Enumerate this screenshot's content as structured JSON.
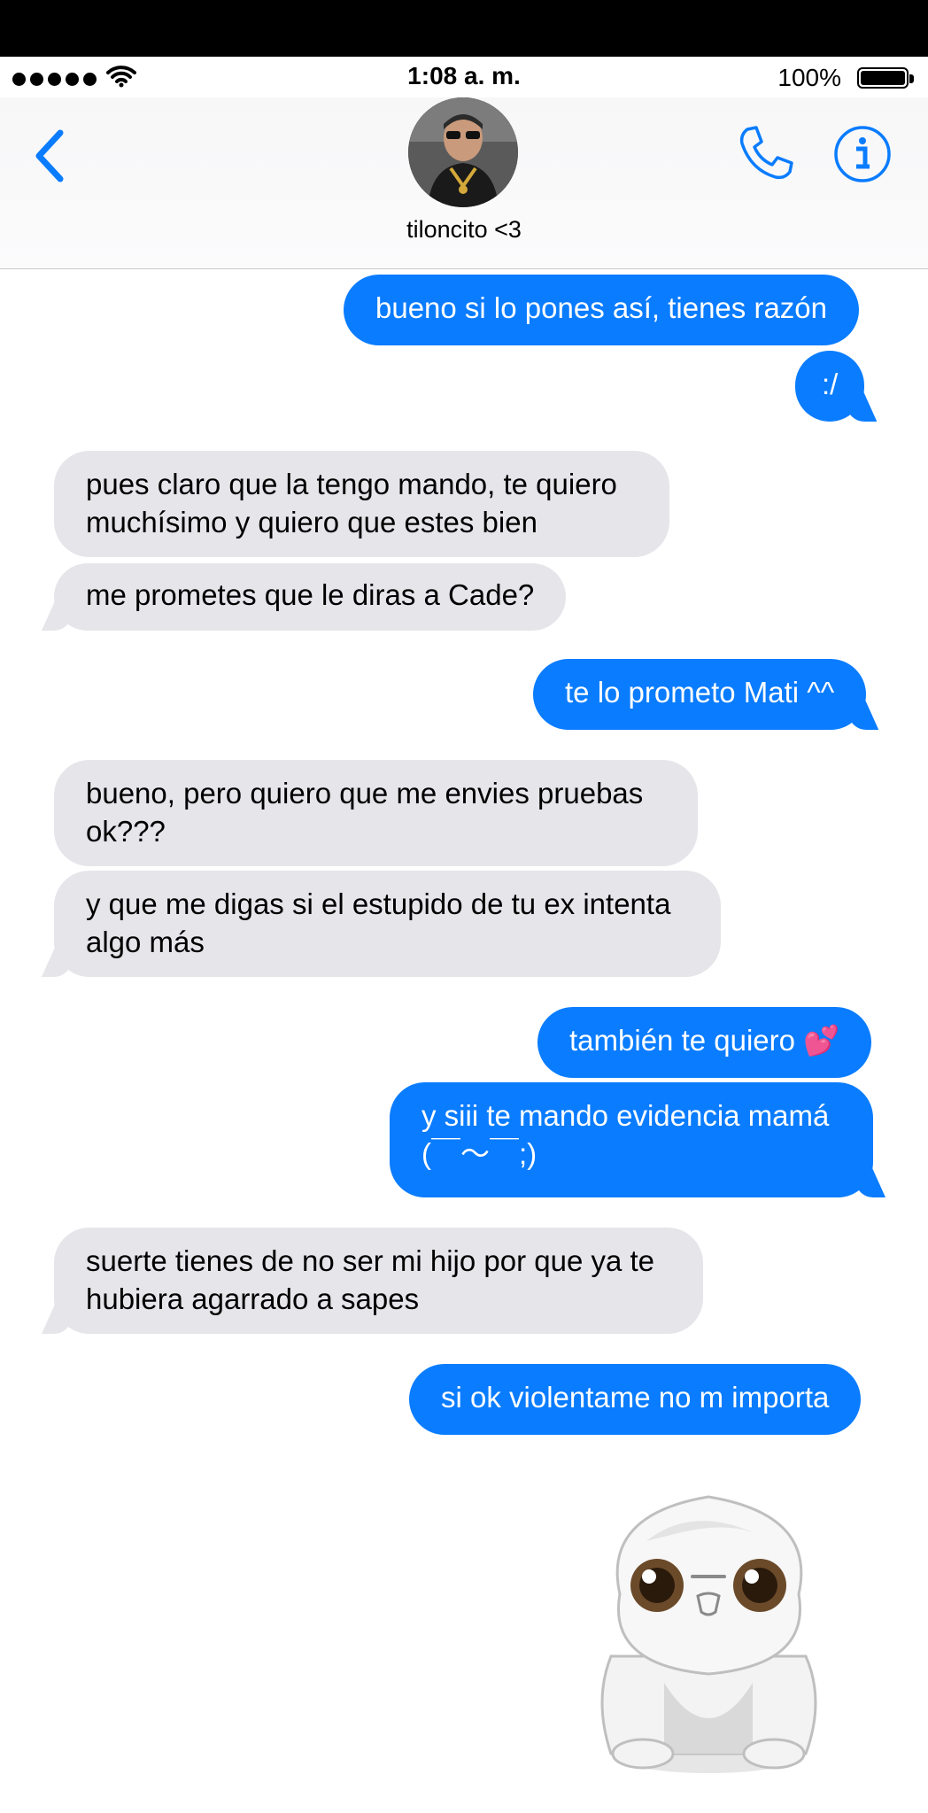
{
  "status_bar": {
    "time": "1:08 a. m.",
    "battery": "100%"
  },
  "header": {
    "contact_name": "tiloncito <3",
    "icons": [
      "back-chevron-icon",
      "avatar",
      "phone-icon",
      "info-icon"
    ]
  },
  "colors": {
    "sent": "#0a7cff",
    "received": "#e5e5ea",
    "accent": "#0a7cff"
  },
  "messages": [
    {
      "from": "me",
      "text": "bueno si lo pones así, tienes razón"
    },
    {
      "from": "me",
      "text": ":/"
    },
    {
      "from": "them",
      "text": "pues claro que la tengo mando, te quiero muchísimo y quiero que estes bien"
    },
    {
      "from": "them",
      "text": "me prometes que le diras a Cade?"
    },
    {
      "from": "me",
      "text": "te lo prometo Mati ^^"
    },
    {
      "from": "them",
      "text": "bueno, pero quiero que me envies pruebas ok???"
    },
    {
      "from": "them",
      "text": "y que me digas si el estupido de tu ex intenta algo más"
    },
    {
      "from": "me",
      "text": "también te quiero 💕"
    },
    {
      "from": "me",
      "text": "y siii te mando evidencia mamá (￣～￣;)"
    },
    {
      "from": "them",
      "text": "suerte tienes de no ser mi hijo por que ya te hubiera agarrado a sapes"
    },
    {
      "from": "me",
      "text": "si ok violentame no m importa"
    }
  ],
  "sticker": {
    "icon": "white-fluffy-creature-sticker"
  }
}
